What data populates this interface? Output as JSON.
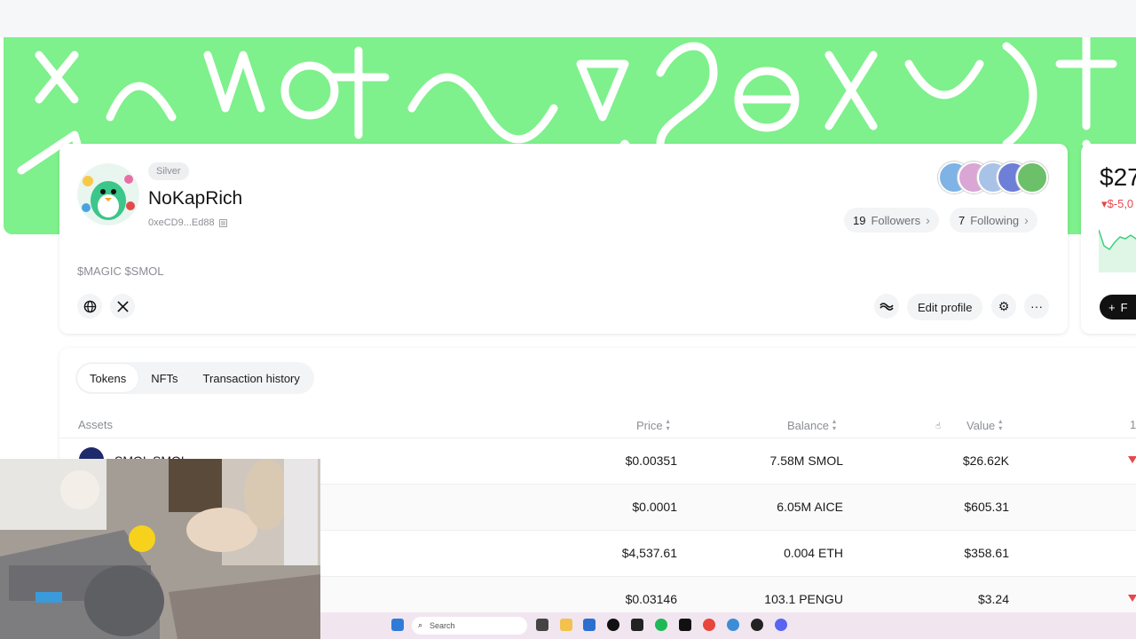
{
  "profile": {
    "tier": "Silver",
    "username": "NoKapRich",
    "address": "0xeCD9...Ed88",
    "bio": "$MAGIC $SMOL",
    "followers_count": "19",
    "followers_label": "Followers",
    "following_count": "7",
    "following_label": "Following",
    "edit_label": "Edit profile"
  },
  "side_panel": {
    "value": "$27",
    "change": "$-5,0",
    "follow_label": "F"
  },
  "tabs": [
    {
      "label": "Tokens",
      "active": true
    },
    {
      "label": "NFTs",
      "active": false
    },
    {
      "label": "Transaction history",
      "active": false
    }
  ],
  "table": {
    "headers": {
      "assets": "Assets",
      "price": "Price",
      "balance": "Balance",
      "value": "Value",
      "extra": "1"
    },
    "rows": [
      {
        "asset": "SMOL SMOL",
        "price": "$0.00351",
        "balance": "7.58M SMOL",
        "value": "$26.62K",
        "trend": "down"
      },
      {
        "asset": "",
        "price": "$0.0001",
        "balance": "6.05M AICE",
        "value": "$605.31",
        "trend": ""
      },
      {
        "asset": "",
        "price": "$4,537.61",
        "balance": "0.004 ETH",
        "value": "$358.61",
        "trend": ""
      },
      {
        "asset": "",
        "price": "$0.03146",
        "balance": "103.1 PENGU",
        "value": "$3.24",
        "trend": "down"
      }
    ]
  },
  "taskbar": {
    "search_placeholder": "Search"
  },
  "colors": {
    "banner": "#7ef08c",
    "negative": "#e5484d",
    "follow_button": "#111111"
  }
}
